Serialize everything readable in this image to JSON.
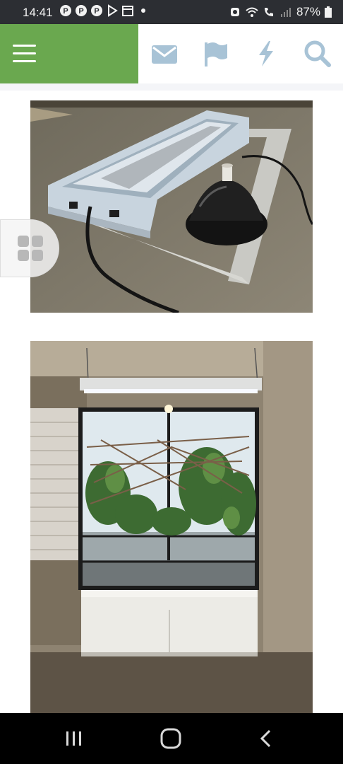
{
  "status": {
    "time": "14:41",
    "battery": "87%",
    "notification_icons": [
      "pinterest-icon",
      "pinterest-icon",
      "pinterest-icon",
      "play-store-icon",
      "calendar-icon",
      "dot-icon"
    ],
    "system_icons": [
      "alarm-icon",
      "wifi-icon",
      "call-icon",
      "signal-icon",
      "battery-icon"
    ]
  },
  "header": {
    "accent_color": "#6aa84f",
    "icon_color": "#a8c3d6",
    "actions": [
      "mail-icon",
      "flag-icon",
      "lightning-icon",
      "search-icon"
    ]
  },
  "gallery": {
    "images": [
      "light-fixture-photo",
      "enclosure-photo"
    ]
  },
  "floating": {
    "icon": "grid-icon"
  },
  "nav": {
    "buttons": [
      "recents-button",
      "home-button",
      "back-button"
    ]
  }
}
